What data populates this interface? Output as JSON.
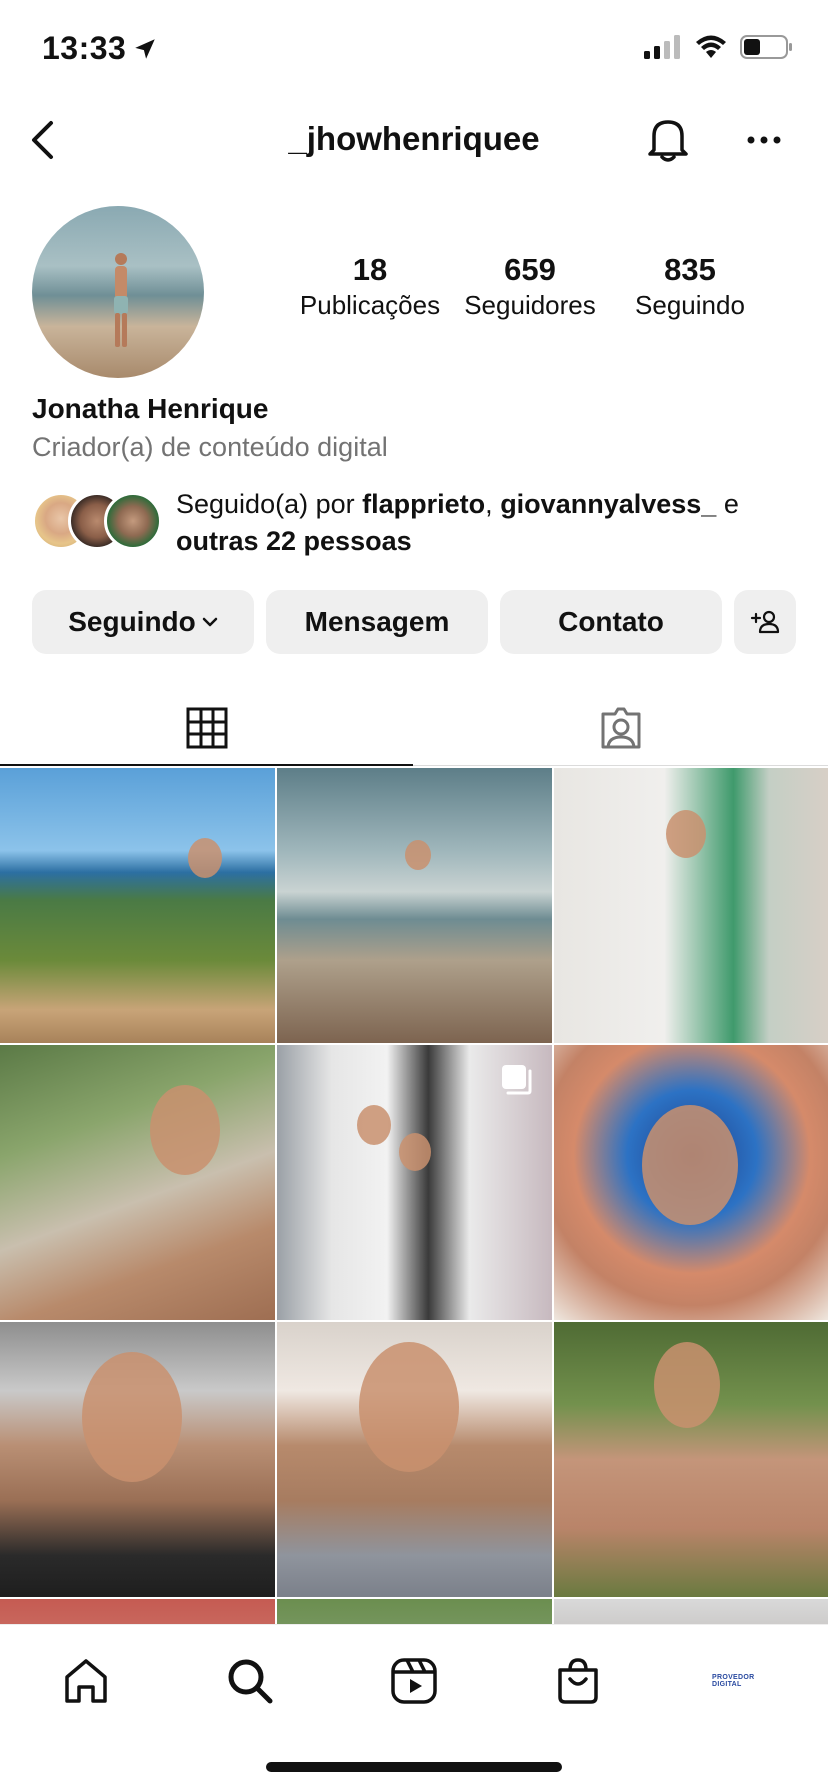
{
  "status_bar": {
    "time": "13:33",
    "icons": [
      "location-arrow-icon",
      "cellular-signal-icon",
      "wifi-icon",
      "battery-icon"
    ]
  },
  "header": {
    "username": "_jhowhenriquee",
    "icons": [
      "chevron-left-icon",
      "bell-icon",
      "more-horizontal-icon"
    ]
  },
  "profile": {
    "stats": [
      {
        "value": "18",
        "label": "Publicações"
      },
      {
        "value": "659",
        "label": "Seguidores"
      },
      {
        "value": "835",
        "label": "Seguindo"
      }
    ],
    "full_name": "Jonatha Henrique",
    "category": "Criador(a) de conteúdo digital",
    "followed_by": {
      "prefix": "Seguido(a) por",
      "user1": "flapprieto",
      "sep": ",",
      "user2": "giovannyalvess_",
      "conj": "e",
      "others": "outras 22 pessoas"
    }
  },
  "actions": {
    "following_label": "Seguindo",
    "message_label": "Mensagem",
    "contact_label": "Contato",
    "suggest_icon": "add-person-icon"
  },
  "tabs": [
    {
      "name": "grid",
      "icon": "grid-icon",
      "active": true
    },
    {
      "name": "tagged",
      "icon": "tagged-person-icon",
      "active": false
    }
  ],
  "bottom_nav": {
    "items": [
      "home-icon",
      "search-icon",
      "reels-icon",
      "shop-bag-icon"
    ],
    "profile_label": "PROVEDOR DIGITAL"
  },
  "colors": {
    "text": "#111111",
    "secondary": "#737373",
    "button_bg": "#efefef",
    "divider": "#dbdbdb"
  }
}
